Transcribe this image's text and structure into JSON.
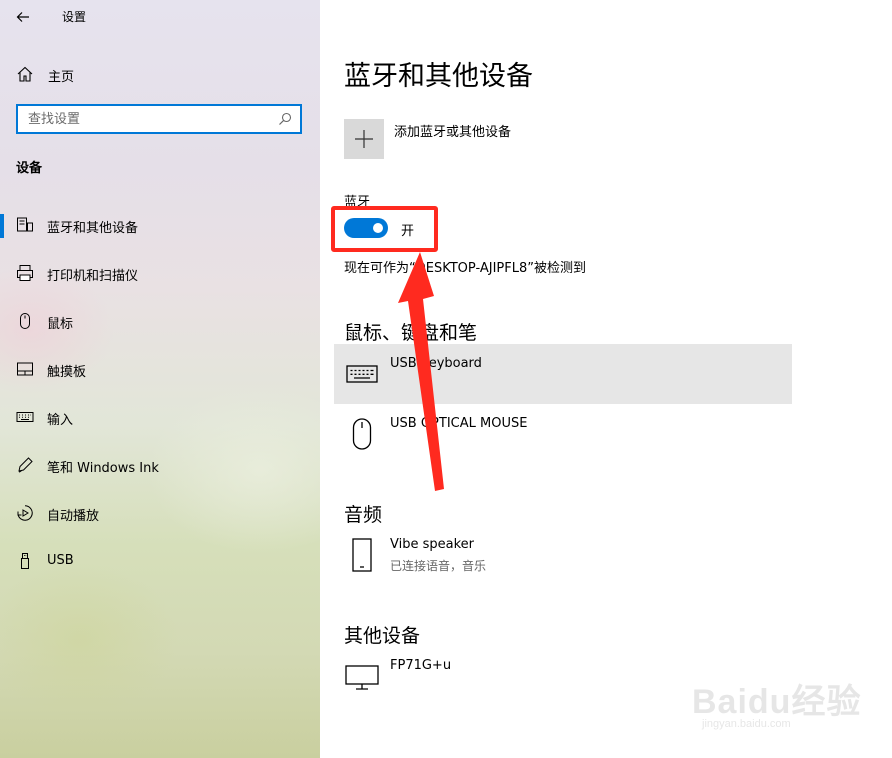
{
  "window": {
    "app_title": "设置"
  },
  "sidebar": {
    "home_label": "主页",
    "search_placeholder": "查找设置",
    "section_label": "设备",
    "items": [
      {
        "label": "蓝牙和其他设备",
        "icon": "bluetooth-devices-icon",
        "selected": true
      },
      {
        "label": "打印机和扫描仪",
        "icon": "printer-icon",
        "selected": false
      },
      {
        "label": "鼠标",
        "icon": "mouse-icon",
        "selected": false
      },
      {
        "label": "触摸板",
        "icon": "touchpad-icon",
        "selected": false
      },
      {
        "label": "输入",
        "icon": "keyboard-icon",
        "selected": false
      },
      {
        "label": "笔和 Windows Ink",
        "icon": "pen-icon",
        "selected": false
      },
      {
        "label": "自动播放",
        "icon": "autoplay-icon",
        "selected": false
      },
      {
        "label": "USB",
        "icon": "usb-icon",
        "selected": false
      }
    ]
  },
  "main": {
    "title": "蓝牙和其他设备",
    "add_device_label": "添加蓝牙或其他设备",
    "bluetooth": {
      "label": "蓝牙",
      "toggle_state": "开",
      "discoverable_text": "现在可作为“DESKTOP-AJIPFL8”被检测到"
    },
    "groups": {
      "input": {
        "title": "鼠标、键盘和笔",
        "devices": [
          {
            "name": "USB Keyboard",
            "status": "",
            "icon": "keyboard-icon"
          },
          {
            "name": "USB OPTICAL MOUSE",
            "status": "",
            "icon": "mouse-icon"
          }
        ]
      },
      "audio": {
        "title": "音频",
        "devices": [
          {
            "name": "Vibe speaker",
            "status": "已连接语音，音乐",
            "icon": "phone-icon"
          }
        ]
      },
      "other": {
        "title": "其他设备",
        "devices": [
          {
            "name": "FP71G+u",
            "status": "",
            "icon": "monitor-icon"
          }
        ]
      }
    }
  },
  "watermark": {
    "brand": "Baidu经验",
    "url": "jingyan.baidu.com"
  },
  "colors": {
    "accent": "#0078d7",
    "annotation": "#ff2a1f",
    "hover_row": "#e6e6e6"
  }
}
